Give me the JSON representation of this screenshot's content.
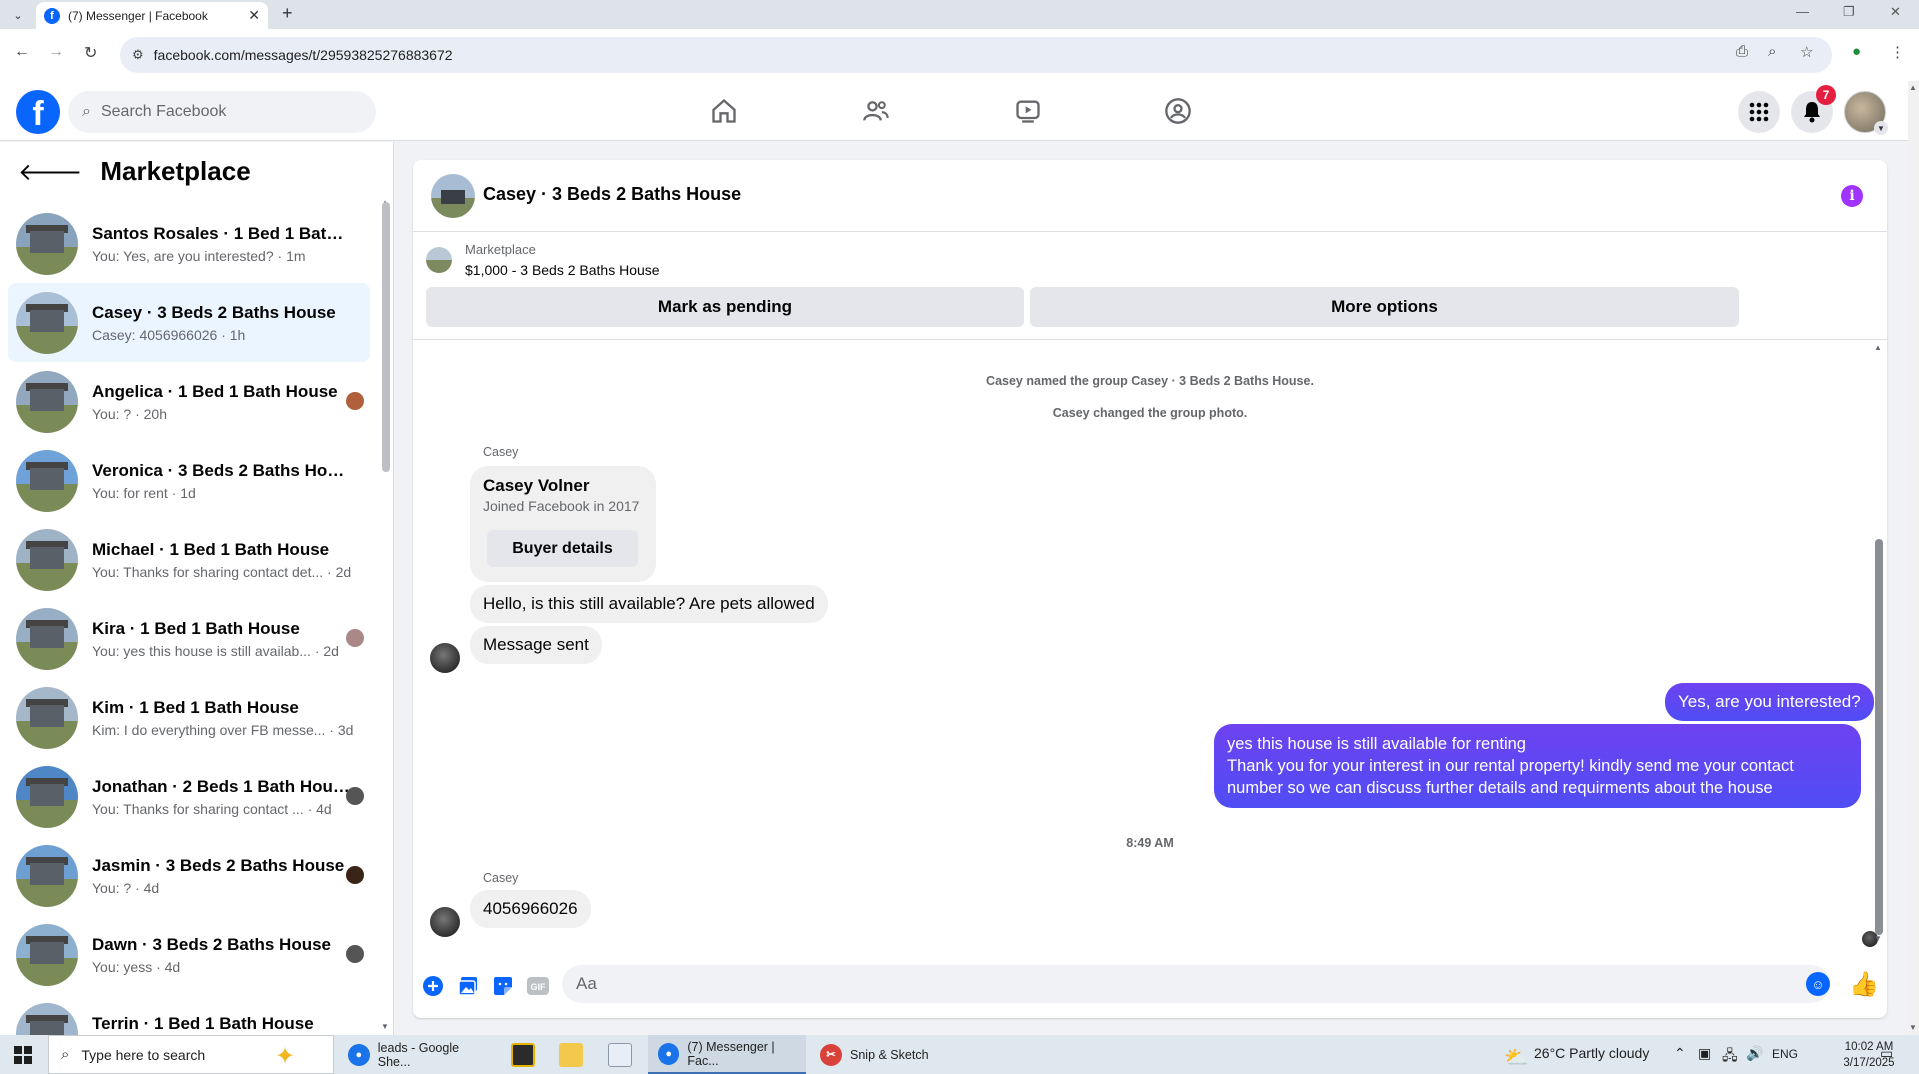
{
  "browser": {
    "tab_title": "(7) Messenger | Facebook",
    "url": "facebook.com/messages/t/29593825276883672"
  },
  "facebook": {
    "search_placeholder": "Search Facebook",
    "notification_count": "7"
  },
  "marketplace": {
    "title": "Marketplace",
    "conversations": [
      {
        "name": "Santos Rosales · 1 Bed 1 Bath Ho...",
        "preview": "You: Yes, are you interested? · 1m",
        "thumb": "#8aa3bd",
        "mini": ""
      },
      {
        "name": "Casey · 3 Beds 2 Baths House",
        "preview": "Casey: 4056966026 · 1h",
        "thumb": "#a9bfd6",
        "mini": ""
      },
      {
        "name": "Angelica · 1 Bed 1 Bath House",
        "preview": "You: ? · 20h",
        "thumb": "#92a8bf",
        "mini": "#b0603a"
      },
      {
        "name": "Veronica · 3 Beds 2 Baths House",
        "preview": "You: for rent · 1d",
        "thumb": "#6fa2d8",
        "mini": ""
      },
      {
        "name": "Michael · 1 Bed 1 Bath House",
        "preview": "You: Thanks for sharing contact det... · 2d",
        "thumb": "#9fb3c7",
        "mini": ""
      },
      {
        "name": "Kira · 1 Bed 1 Bath House",
        "preview": "You: yes this house is still availab... · 2d",
        "thumb": "#98aec4",
        "mini": "#a88"
      },
      {
        "name": "Kim · 1 Bed 1 Bath House",
        "preview": "Kim: I do everything over FB messe... · 3d",
        "thumb": "#a5b8ca",
        "mini": ""
      },
      {
        "name": "Jonathan · 2 Beds 1 Bath House",
        "preview": "You: Thanks for sharing contact ... · 4d",
        "thumb": "#4f86c6",
        "mini": "#555"
      },
      {
        "name": "Jasmin · 3 Beds 2 Baths House",
        "preview": "You: ? · 4d",
        "thumb": "#6e9fd2",
        "mini": "#3a2418"
      },
      {
        "name": "Dawn · 3 Beds 2 Baths House",
        "preview": "You: yess · 4d",
        "thumb": "#8eb0cf",
        "mini": "#555"
      },
      {
        "name": "Terrin · 1 Bed 1 Bath House",
        "preview": "You: ? · 5d",
        "thumb": "#9fb6cc",
        "mini": ""
      }
    ]
  },
  "chat": {
    "title": "Casey · 3 Beds 2 Baths House",
    "listing_category": "Marketplace",
    "listing_price_title": "$1,000 - 3 Beds 2 Baths House",
    "mark_pending": "Mark as pending",
    "more_options": "More options",
    "system_1": "Casey named the group Casey · 3 Beds 2 Baths House.",
    "system_2": "Casey changed the group photo.",
    "sender_1": "Casey",
    "card_name": "Casey Volner",
    "card_joined": "Joined Facebook in 2017",
    "card_button": "Buyer details",
    "msg_1": "Hello, is this still available? Are pets allowed",
    "msg_2": "Message sent",
    "out_1": "Yes, are you interested?",
    "out_2": "yes this house is still available for renting\nThank you for your interest in our rental property! kindly send me your contact number so we can discuss further details and requirments about the house",
    "timestamp": "8:49 AM",
    "sender_2": "Casey",
    "msg_3": "4056966026",
    "composer_placeholder": "Aa"
  },
  "taskbar": {
    "search_placeholder": "Type here to search",
    "apps": [
      {
        "label": "leads - Google She...",
        "color": "#1a73e8"
      },
      {
        "label": "(7) Messenger | Fac...",
        "color": "#1a73e8"
      },
      {
        "label": "Snip & Sketch",
        "color": "#d9423a"
      }
    ],
    "weather": "26°C  Partly cloudy",
    "lang": "ENG",
    "time": "10:02 AM",
    "date": "3/17/2025"
  }
}
